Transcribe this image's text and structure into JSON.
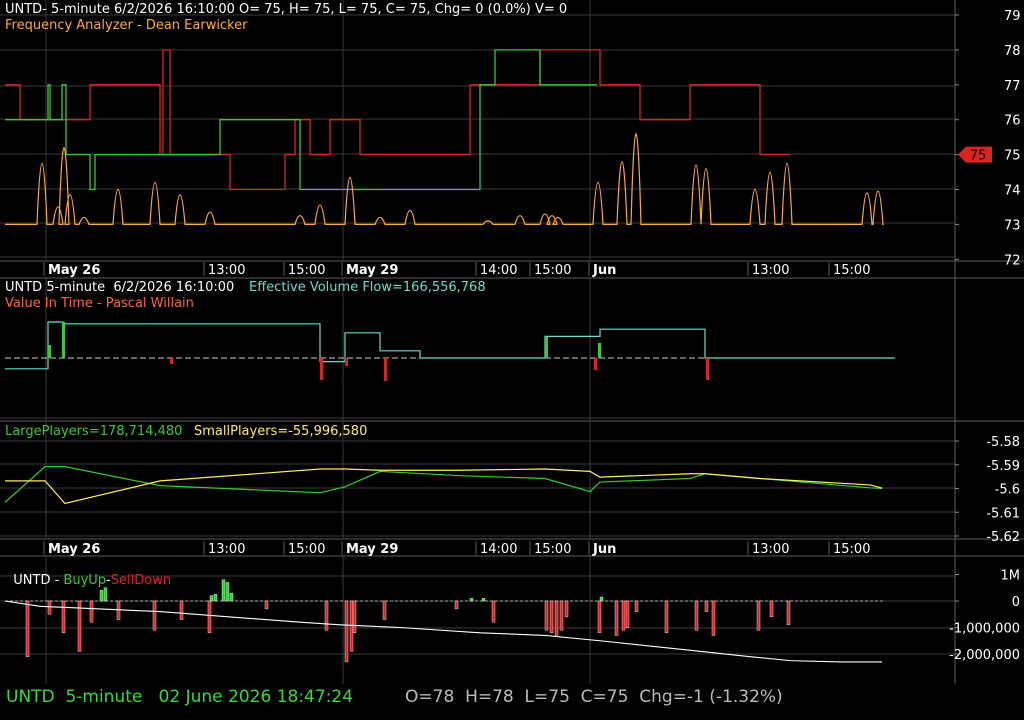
{
  "colors": {
    "background": "#000000",
    "grid": "#3a3a3a",
    "separator": "#5a5a5a",
    "text": "#ffffff",
    "green": "#33cc33",
    "red": "#dd2222",
    "orange": "#ffaa33",
    "yellow": "#ffee55",
    "cyan": "#66ddcc",
    "status_green": "#33dd33",
    "status_gray": "#bbbbbb"
  },
  "panels": {
    "price": {
      "header": "UNTD- 5-minute 6/2/2026 16:10:00 O= 75, H= 75, L= 75, C= 75, Chg= 0 (0.0%) V= 0",
      "subtitle": "Frequency Analyzer - Dean Earwicker"
    },
    "volume_flow": {
      "header": "UNTD 5-minute  6/2/2026 16:10:00",
      "indicator_value": "Effective Volume Flow=166,556,768",
      "subtitle": "Value In Time - Pascal Willain"
    },
    "players": {
      "large_label": "LargePlayers=178,714,480",
      "small_label": "SmallPlayers=-55,996,580"
    },
    "buyup": {
      "prefix": "UNTD - ",
      "buy_label": "BuyUp",
      "dash": "-",
      "sell_label": "SellDown"
    }
  },
  "status_bar": {
    "symbol_info": "UNTD  5-minute   02 June 2026 18:47:24",
    "ohlc": "O=78  H=78  L=75  C=75  Chg=-1 (-1.32%)"
  },
  "chart_data": [
    {
      "type": "line",
      "title": "Frequency Analyzer - Dean Earwicker",
      "x_time_labels": [
        "May 26",
        "13:00",
        "15:00",
        "May 29",
        "14:00",
        "15:00",
        "Jun",
        "13:00",
        "15:00"
      ],
      "y_ticks": [
        "79",
        "78",
        "77",
        "76",
        "75",
        "74",
        "73",
        "72"
      ],
      "ylim": [
        71.6,
        79.4
      ],
      "last_price_marker": "75",
      "series": [
        {
          "color": "red",
          "step_values": [
            77,
            76,
            77,
            75,
            78,
            75,
            74,
            75,
            76,
            75,
            76,
            76,
            75,
            77,
            78,
            77,
            76,
            77,
            75
          ]
        },
        {
          "color": "green",
          "step_values": [
            76,
            77,
            76,
            77,
            75,
            74,
            75,
            76,
            74,
            77,
            78,
            77
          ]
        },
        {
          "color": "orange",
          "spike_values": [
            73,
            76.5,
            74,
            77.4,
            74.7,
            73.4,
            75,
            75.4,
            74.7,
            73.7,
            73,
            73.5,
            74.1,
            75.7,
            73.4,
            73.8,
            73,
            73.2,
            73.5,
            73.6,
            73.5,
            73.4,
            75.4,
            76.6,
            78.2,
            76.4,
            76.2,
            75,
            76,
            76.5,
            74.8,
            74.9,
            75.2,
            75.8,
            73.1,
            73
          ]
        }
      ]
    },
    {
      "type": "line",
      "title": "Effective Volume Flow",
      "series": [
        {
          "name": "Effective Volume Flow",
          "color": "cyan",
          "levels": [
            -0.3,
            1,
            0.95,
            -0.1,
            0.7,
            0.2,
            0,
            0.6,
            0.8,
            0,
            0,
            0
          ]
        }
      ]
    },
    {
      "type": "line",
      "y_ticks": [
        "-5.58",
        "-5.59",
        "-5.6",
        "-5.61",
        "-5.62"
      ],
      "ylim": [
        -5.623,
        -5.575
      ],
      "series": [
        {
          "name": "LargePlayers",
          "color": "green",
          "values": [
            -5.6058,
            -5.5908,
            -5.5908,
            -5.5988,
            -5.6018,
            -5.5993,
            -5.5928,
            -5.5946,
            -5.5958,
            -5.6013,
            -5.5973,
            -5.5958,
            -5.5938,
            -5.5958,
            -5.5997,
            -5.6
          ],
          "value_label": "178,714,480"
        },
        {
          "name": "SmallPlayers",
          "color": "yellow",
          "values": [
            -5.5968,
            -5.5968,
            -5.6063,
            -5.5968,
            -5.5918,
            -5.5918,
            -5.5923,
            -5.5923,
            -5.5918,
            -5.5928,
            -5.5952,
            -5.5938,
            -5.5938,
            -5.5958,
            -5.5985,
            -5.5998
          ],
          "value_label": "-55,996,580"
        }
      ]
    },
    {
      "type": "bar",
      "title": "BuyUp-SellDown",
      "y_ticks": [
        "1M",
        "0",
        "-1,000,000",
        "-2,000,000"
      ],
      "ylim": [
        -2500000,
        1300000
      ],
      "series": [
        {
          "name": "BuyUp",
          "color": "green",
          "values": [
            400000,
            500000,
            200000,
            250000,
            800000,
            700000,
            300000,
            100000,
            100000,
            150000
          ]
        },
        {
          "name": "SellDown",
          "color": "red",
          "values": [
            -2100000,
            -500000,
            -1200000,
            -1900000,
            -800000,
            -700000,
            -1100000,
            -700000,
            -1200000,
            -300000,
            -1100000,
            -2300000,
            -1900000,
            -1200000,
            -700000,
            -300000,
            -800000,
            -1100000,
            -1200000,
            -1300000,
            -1100000,
            -600000,
            -1200000,
            -1300000,
            -1100000,
            -1000000,
            -400000,
            -1200000,
            -1100000,
            -400000,
            -1300000,
            -1100000,
            -600000,
            -900000
          ]
        },
        {
          "name": "Cumulative",
          "color": "white",
          "values": [
            0,
            -200000,
            -300000,
            -400000,
            -600000,
            -800000,
            -900000,
            -1000000,
            -1200000,
            -1300000,
            -1500000,
            -1700000,
            -1900000,
            -2100000,
            -2250000,
            -2300000,
            -2300000
          ]
        }
      ]
    }
  ]
}
